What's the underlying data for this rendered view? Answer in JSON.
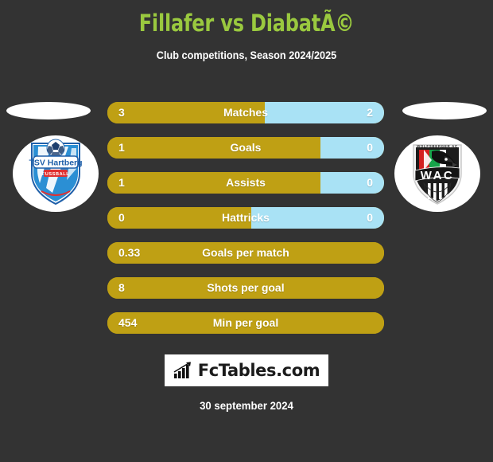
{
  "header": {
    "title": "Fillafer vs DiabatÃ©",
    "subtitle": "Club competitions, Season 2024/2025"
  },
  "colors": {
    "background": "#333333",
    "title": "#9ac93f",
    "home_bar": "#bfa014",
    "away_bar": "#a9e2f5",
    "text": "#ffffff"
  },
  "home_club": {
    "name": "TSV Hartberg",
    "sub": "FUSSBALL",
    "crest_icon": "tsv-hartberg-crest-icon"
  },
  "away_club": {
    "name": "WAC",
    "sub": "WOLFSBERGER AC",
    "crest_icon": "wac-crest-icon"
  },
  "stats": [
    {
      "label": "Matches",
      "home": "3",
      "away": "2",
      "home_pct": 57,
      "split": true
    },
    {
      "label": "Goals",
      "home": "1",
      "away": "0",
      "home_pct": 77,
      "split": true
    },
    {
      "label": "Assists",
      "home": "1",
      "away": "0",
      "home_pct": 77,
      "split": true
    },
    {
      "label": "Hattricks",
      "home": "0",
      "away": "0",
      "home_pct": 52,
      "split": true
    },
    {
      "label": "Goals per match",
      "home": "0.33",
      "away": "",
      "home_pct": 100,
      "split": false
    },
    {
      "label": "Shots per goal",
      "home": "8",
      "away": "",
      "home_pct": 100,
      "split": false
    },
    {
      "label": "Min per goal",
      "home": "454",
      "away": "",
      "home_pct": 100,
      "split": false
    }
  ],
  "footer": {
    "brand": "FcTables.com",
    "brand_icon": "bar-chart-growth-icon",
    "date": "30 september 2024"
  }
}
